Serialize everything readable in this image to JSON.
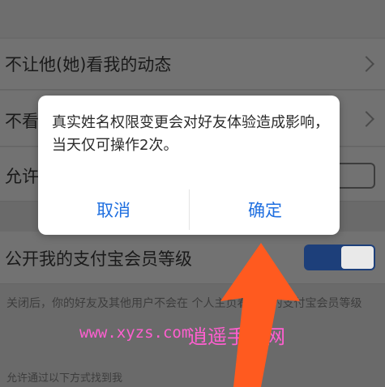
{
  "settings": {
    "rows": [
      {
        "label": "不让他(她)看我的动态",
        "control": "chevron"
      },
      {
        "label": "不看",
        "control": "chevron"
      },
      {
        "label": "允许",
        "control": "toggle",
        "checked": false
      },
      {
        "label": "公开我的支付宝会员等级",
        "control": "toggle",
        "checked": true
      }
    ],
    "description": "关闭后，你的好友及其他用户不会在      个人主页看到你的支付宝会员等级",
    "footer": "允许通过以下方式找到我"
  },
  "dialog": {
    "message": "真实姓名权限变更会对好友体验造成影响，当天仅可操作2次。",
    "cancel_label": "取消",
    "confirm_label": "确定",
    "confirm_color": "#1f6fe0"
  },
  "watermark": {
    "url": "www.xyzs.com",
    "brand": "逍遥手游网"
  },
  "overlay": {
    "arrow_color": "#ff5a1f"
  }
}
